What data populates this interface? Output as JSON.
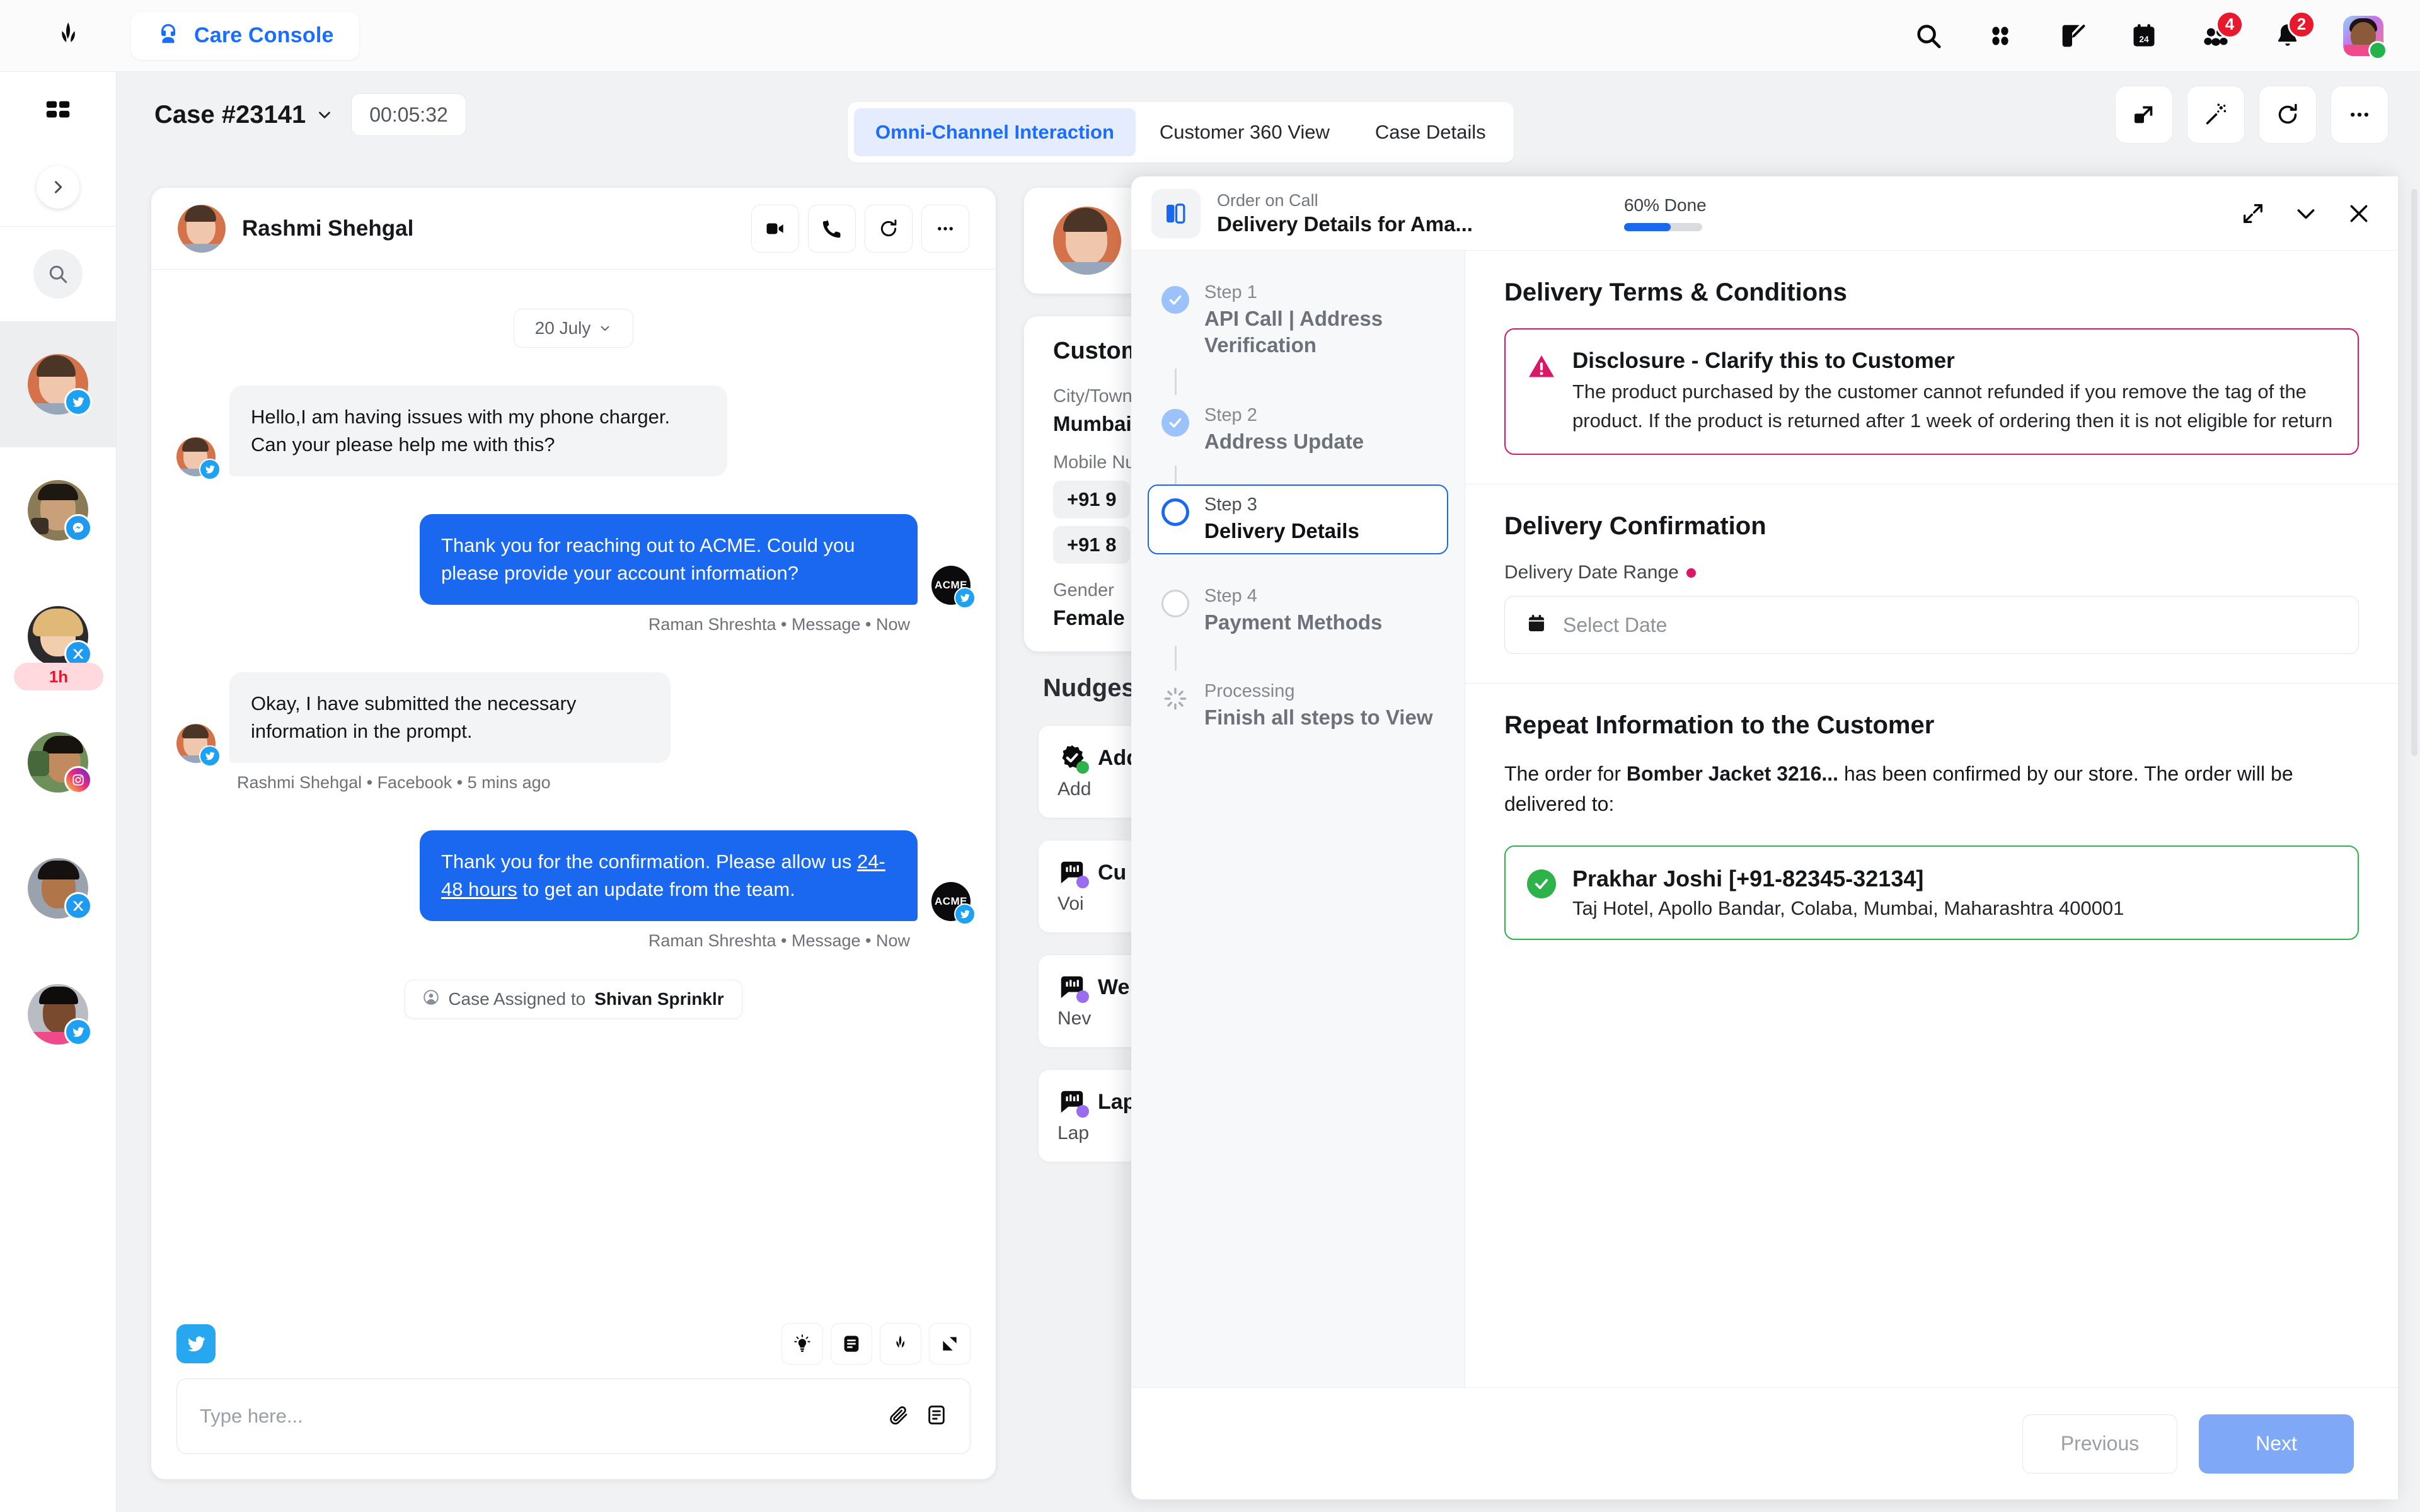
{
  "topbar": {
    "brand_logo": "sprinklr-logo",
    "care_console": {
      "label": "Care Console",
      "icon": "headset-icon"
    },
    "icons": [
      {
        "name": "search-icon",
        "badge": null
      },
      {
        "name": "apps-grid-icon",
        "badge": null
      },
      {
        "name": "compose-edit-icon",
        "badge": null
      },
      {
        "name": "calendar-24-icon",
        "badge": null
      },
      {
        "name": "people-icon",
        "badge": "4"
      },
      {
        "name": "bell-icon",
        "badge": "2"
      }
    ],
    "avatar": {
      "name": "user-avatar",
      "status": "online"
    }
  },
  "rail": {
    "grid_icon": "dashboard-grid-icon",
    "expand_icon": "chevron-right-icon",
    "search_icon": "search-icon",
    "items": [
      {
        "channel": "twitter",
        "active": true,
        "sla": null
      },
      {
        "channel": "messenger",
        "active": false,
        "sla": null
      },
      {
        "channel": "x",
        "active": false,
        "sla": "1h"
      },
      {
        "channel": "instagram",
        "active": false,
        "sla": null
      },
      {
        "channel": "x",
        "active": false,
        "sla": null
      },
      {
        "channel": "twitter",
        "active": false,
        "sla": null
      }
    ]
  },
  "case_header": {
    "title": "Case #23141",
    "caret_icon": "chevron-down-icon",
    "timer": "00:05:32",
    "tabs": [
      {
        "label": "Omni-Channel Interaction",
        "active": true
      },
      {
        "label": "Customer 360 View",
        "active": false
      },
      {
        "label": "Case Details",
        "active": false
      }
    ],
    "actions": [
      {
        "name": "open-in-new-icon"
      },
      {
        "name": "magic-wand-icon"
      },
      {
        "name": "refresh-icon"
      },
      {
        "name": "more-options-icon"
      }
    ]
  },
  "chat": {
    "contact_name": "Rashmi Shehgal",
    "header_actions": [
      {
        "name": "video-call-icon"
      },
      {
        "name": "phone-call-icon"
      },
      {
        "name": "refresh-icon"
      },
      {
        "name": "more-options-icon"
      }
    ],
    "date_divider": "20 July",
    "messages": [
      {
        "direction": "in",
        "text": "Hello,I am having issues with my phone charger. Can your please help me with this?",
        "meta": "",
        "channel": "twitter"
      },
      {
        "direction": "out",
        "text": "Thank you for reaching out to ACME. Could you please provide your account information?",
        "meta": "Raman Shreshta • Message • Now",
        "avatar_label": "ACME",
        "channel": "twitter"
      },
      {
        "direction": "in",
        "text": "Okay, I have submitted the necessary information in the prompt.",
        "meta": "Rashmi Shehgal • Facebook • 5 mins ago",
        "channel": "twitter"
      },
      {
        "direction": "out",
        "text_before": "Thank you for the confirmation. Please allow us ",
        "text_link": "24-48 hours",
        "text_after": " to get an update from the team.",
        "meta": "Raman Shreshta • Message • Now",
        "avatar_label": "ACME",
        "channel": "twitter"
      }
    ],
    "assignment": {
      "prefix": "Case Assigned to ",
      "assignee": "Shivan Sprinklr",
      "icon": "person-circle-icon"
    },
    "composer": {
      "channel_icon": "twitter-icon",
      "tools": [
        {
          "name": "lightbulb-suggestion-icon"
        },
        {
          "name": "notes-icon"
        },
        {
          "name": "sprinklr-ai-icon"
        },
        {
          "name": "knowledge-base-icon"
        }
      ],
      "placeholder": "Type here...",
      "value": "",
      "attach_icon": "paperclip-icon",
      "template_icon": "template-icon"
    }
  },
  "mid_column": {
    "customer_card_title": "Customer",
    "fields": [
      {
        "label": "City/Town",
        "value": "Mumbai"
      },
      {
        "label": "Mobile Number",
        "values": [
          "+91 9",
          "+91 8"
        ]
      },
      {
        "label": "Gender",
        "value": "Female"
      }
    ],
    "nudges_title": "Nudges",
    "nudges": [
      {
        "icon": "verified-badge-icon",
        "dot": "#2db34a",
        "title": "Add",
        "subtitle": "Add"
      },
      {
        "icon": "voice-comment-icon",
        "dot": "#9a6cf0",
        "title": "Cu",
        "subtitle": "Voi"
      },
      {
        "icon": "voice-comment-icon",
        "dot": "#9a6cf0",
        "title": "We",
        "subtitle": "Nev"
      },
      {
        "icon": "voice-comment-icon",
        "dot": "#9a6cf0",
        "title": "Lap",
        "subtitle": "Lap"
      }
    ]
  },
  "modal": {
    "icon": "side-panel-icon",
    "subtitle": "Order on Call",
    "title": "Delivery Details for Ama...",
    "progress_label": "60% Done",
    "progress_percent": 60,
    "actions": [
      {
        "name": "expand-diagonal-icon"
      },
      {
        "name": "chevron-down-icon"
      },
      {
        "name": "close-icon"
      }
    ],
    "steps": [
      {
        "number": "Step 1",
        "title": "API Call | Address Verification",
        "state": "done"
      },
      {
        "number": "Step 2",
        "title": "Address Update",
        "state": "done"
      },
      {
        "number": "Step 3",
        "title": "Delivery Details",
        "state": "active"
      },
      {
        "number": "Step 4",
        "title": "Payment Methods",
        "state": "todo"
      },
      {
        "number": "Processing",
        "title": "Finish all steps to View",
        "state": "processing"
      }
    ],
    "terms": {
      "heading": "Delivery Terms & Conditions",
      "alert_icon": "warning-triangle-icon",
      "alert_title": "Disclosure - Clarify this to Customer",
      "alert_body": "The product purchased by the customer cannot refunded if you remove the tag of the product. If the product is returned after 1 week of ordering then it is not eligible for return",
      "alert_color": "#dd1768"
    },
    "confirmation": {
      "heading": "Delivery Confirmation",
      "field_label": "Delivery Date Range",
      "required": true,
      "date_icon": "calendar-icon",
      "date_placeholder": "Select Date",
      "date_value": ""
    },
    "repeat": {
      "heading": "Repeat Information to the Customer",
      "text_before": "The order for ",
      "product": "Bomber Jacket 3216...",
      "text_after": " has been confirmed by our store. The order will be delivered to:",
      "address_icon": "check-circle-icon",
      "address_color": "#2db34a",
      "recipient": "Prakhar Joshi [+91-82345-32134]",
      "address": "Taj Hotel, Apollo Bandar, Colaba, Mumbai, Maharashtra 400001"
    },
    "footer": {
      "previous_label": "Previous",
      "next_label": "Next"
    }
  }
}
